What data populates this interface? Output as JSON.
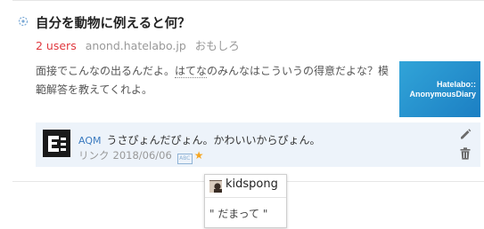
{
  "entry": {
    "title": "自分を動物に例えると何？",
    "users": "2 users",
    "domain": "anond.hatelabo.jp",
    "category": "おもしろ",
    "summary_before": "面接でこんなの出るんだよ。",
    "summary_keyword": "はてな",
    "summary_after": "のみんなはこういうの得意だよな？模範解答を教えてくれよ。",
    "thumbnail_line1": "Hatelabo::",
    "thumbnail_line2": "AnonymousDiary",
    "icon": "bookmark-entry-icon"
  },
  "comment": {
    "user": "AQM",
    "text": "うさぴょんだぴょん。かわいいからぴょん。",
    "link_label": "リンク",
    "date": "2018/06/06",
    "badge": "ABC",
    "star": "★",
    "edit_icon": "pencil-icon",
    "delete_icon": "trash-icon"
  },
  "popup": {
    "user": "kidspong",
    "quote": "\" だまって \""
  },
  "colors": {
    "users": "#e0383e",
    "link": "#3b7bbf",
    "comment_bg": "#edf3fa",
    "thumbnail": "#2596d1",
    "star": "#f5a623"
  }
}
